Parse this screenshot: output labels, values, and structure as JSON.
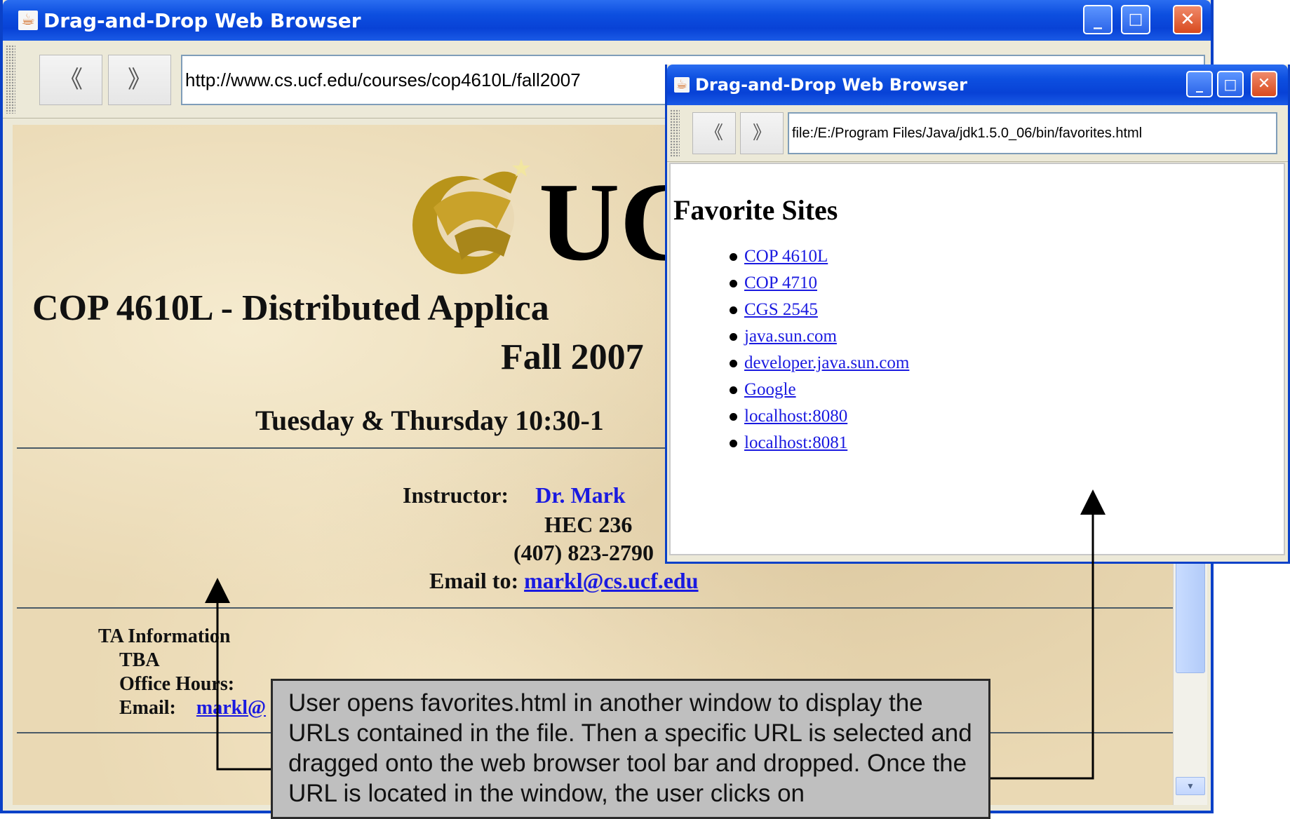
{
  "main_window": {
    "title": "Drag-and-Drop Web Browser",
    "back_label": "《",
    "forward_label": "》",
    "url": "http://www.cs.ucf.edu/courses/cop4610L/fall2007",
    "logo_text": "UC",
    "course_title_line1": "COP 4610L - Distributed Applica",
    "course_title_line2": "Fall 2007",
    "schedule": "Tuesday & Thursday 10:30-1",
    "instructor_label": "Instructor:",
    "instructor_name": "Dr. Mark",
    "office": "HEC 236",
    "phone": "(407) 823-2790",
    "email_label": "Email to:",
    "email": "markl@cs.ucf.edu ",
    "ta_heading": "TA Information",
    "ta_name": "TBA",
    "ta_office_hours_label": "Office Hours:",
    "ta_email_label": "Email:",
    "ta_email": "markl@"
  },
  "fav_window": {
    "title": "Drag-and-Drop Web Browser",
    "back_label": "《",
    "forward_label": "》",
    "url": "file:/E:/Program Files/Java/jdk1.5.0_06/bin/favorites.html",
    "heading": "Favorite Sites",
    "links": [
      "COP 4610L",
      "COP 4710",
      "CGS 2545",
      "java.sun.com",
      "developer.java.sun.com",
      "Google",
      "localhost:8080",
      "localhost:8081"
    ]
  },
  "callout_text": "User opens favorites.html in another window to display the URLs contained in the file.  Then a specific URL is selected and dragged onto the web browser tool bar and dropped.  Once the URL is located in the window, the user clicks on",
  "colors": {
    "titlebar_blue": "#0842d6",
    "link_blue": "#1a1ae0",
    "ucf_gold": "#b8941a",
    "close_red": "#d84a1e"
  },
  "icons": {
    "minimize": "minimize-icon",
    "maximize": "maximize-icon",
    "close": "close-icon",
    "back": "chevron-left-icon",
    "forward": "chevron-right-icon",
    "java": "java-cup-icon"
  }
}
